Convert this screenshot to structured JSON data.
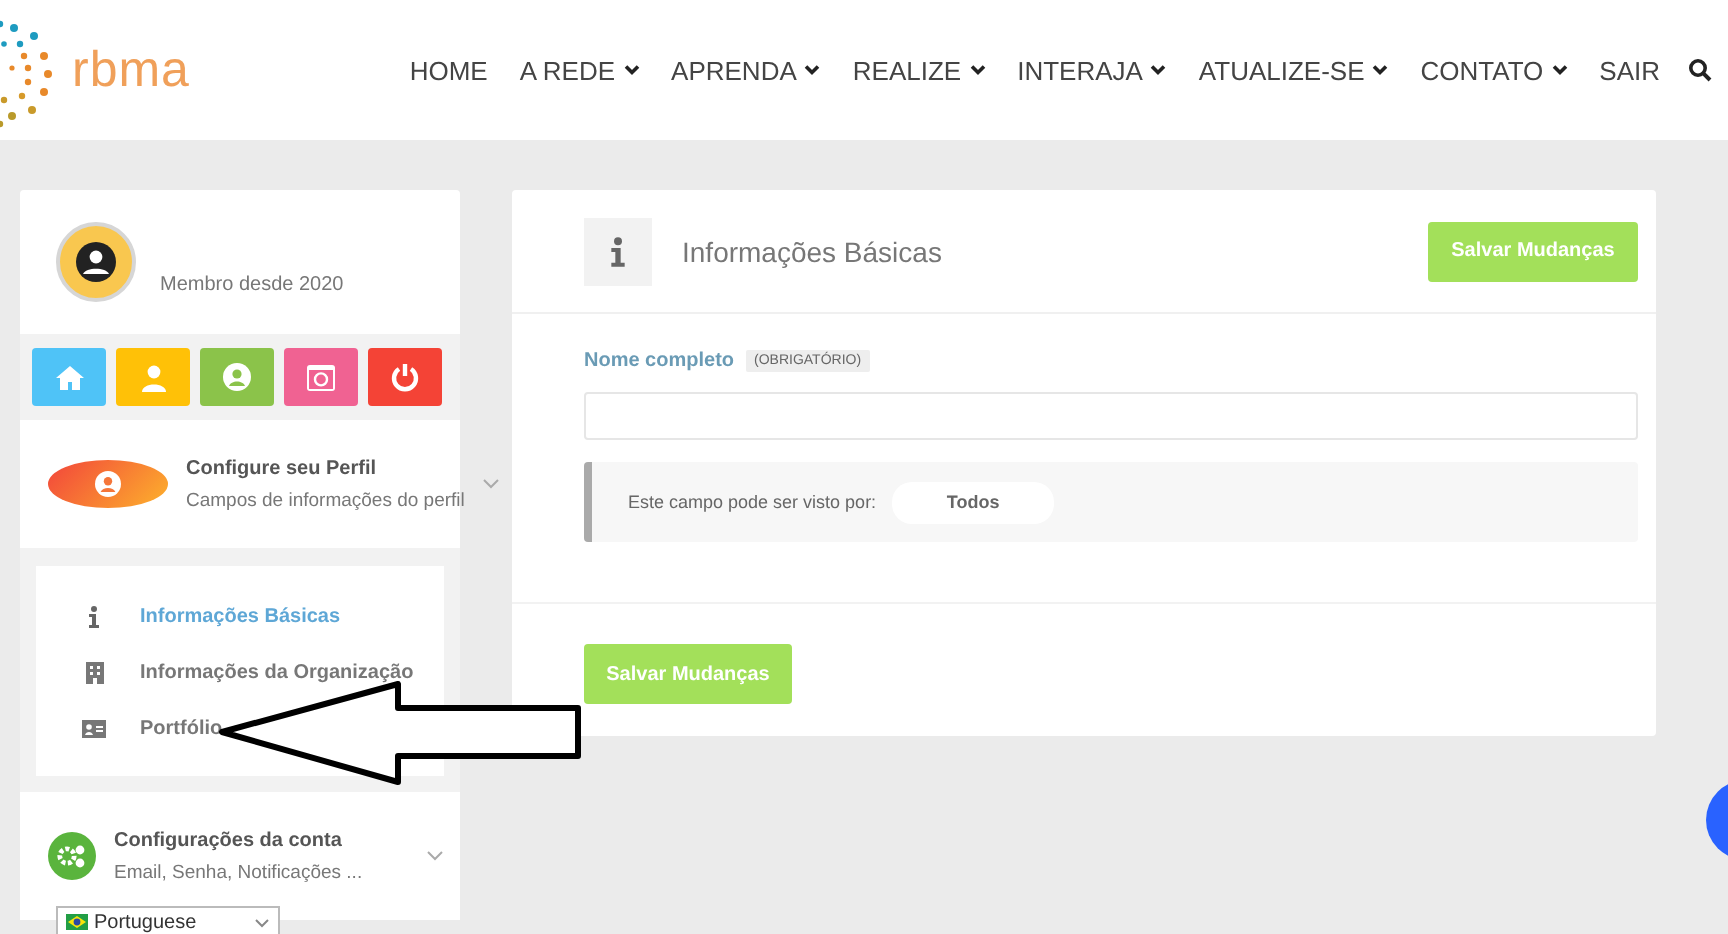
{
  "logo": {
    "text": "rbma"
  },
  "nav": [
    {
      "label": "HOME",
      "dropdown": false
    },
    {
      "label": "A REDE",
      "dropdown": true
    },
    {
      "label": "APRENDA",
      "dropdown": true
    },
    {
      "label": "REALIZE",
      "dropdown": true
    },
    {
      "label": "INTERAJA",
      "dropdown": true
    },
    {
      "label": "ATUALIZE-SE",
      "dropdown": true
    },
    {
      "label": "CONTATO",
      "dropdown": true
    },
    {
      "label": "SAIR",
      "dropdown": false
    }
  ],
  "sidebar": {
    "member_since": "Membro desde 2020",
    "shortcuts": [
      {
        "kind": "home",
        "color": "#4fc3f7"
      },
      {
        "kind": "user",
        "color": "#ffc107"
      },
      {
        "kind": "profile",
        "color": "#8bc34a"
      },
      {
        "kind": "media",
        "color": "#f06292"
      },
      {
        "kind": "power",
        "color": "#f44336"
      }
    ],
    "sections": [
      {
        "kind": "profile",
        "title": "Configure seu Perfil",
        "subtitle": "Campos de informações do perfil",
        "items": [
          {
            "kind": "info",
            "label": "Informações Básicas",
            "selected": true
          },
          {
            "kind": "building",
            "label": "Informações da Organização",
            "selected": false
          },
          {
            "kind": "card",
            "label": "Portfólio",
            "selected": false
          }
        ]
      },
      {
        "kind": "account",
        "title": "Configurações da conta",
        "subtitle": "Email, Senha, Notificações ..."
      }
    ],
    "language": "Portuguese"
  },
  "main": {
    "title": "Informações Básicas",
    "save_label": "Salvar Mudanças",
    "field": {
      "label": "Nome completo",
      "badge": "(OBRIGATÓRIO)",
      "visibility_label": "Este campo pode ser visto por:",
      "visibility_value": "Todos"
    },
    "footer_button": "Salvar Mudanças"
  }
}
